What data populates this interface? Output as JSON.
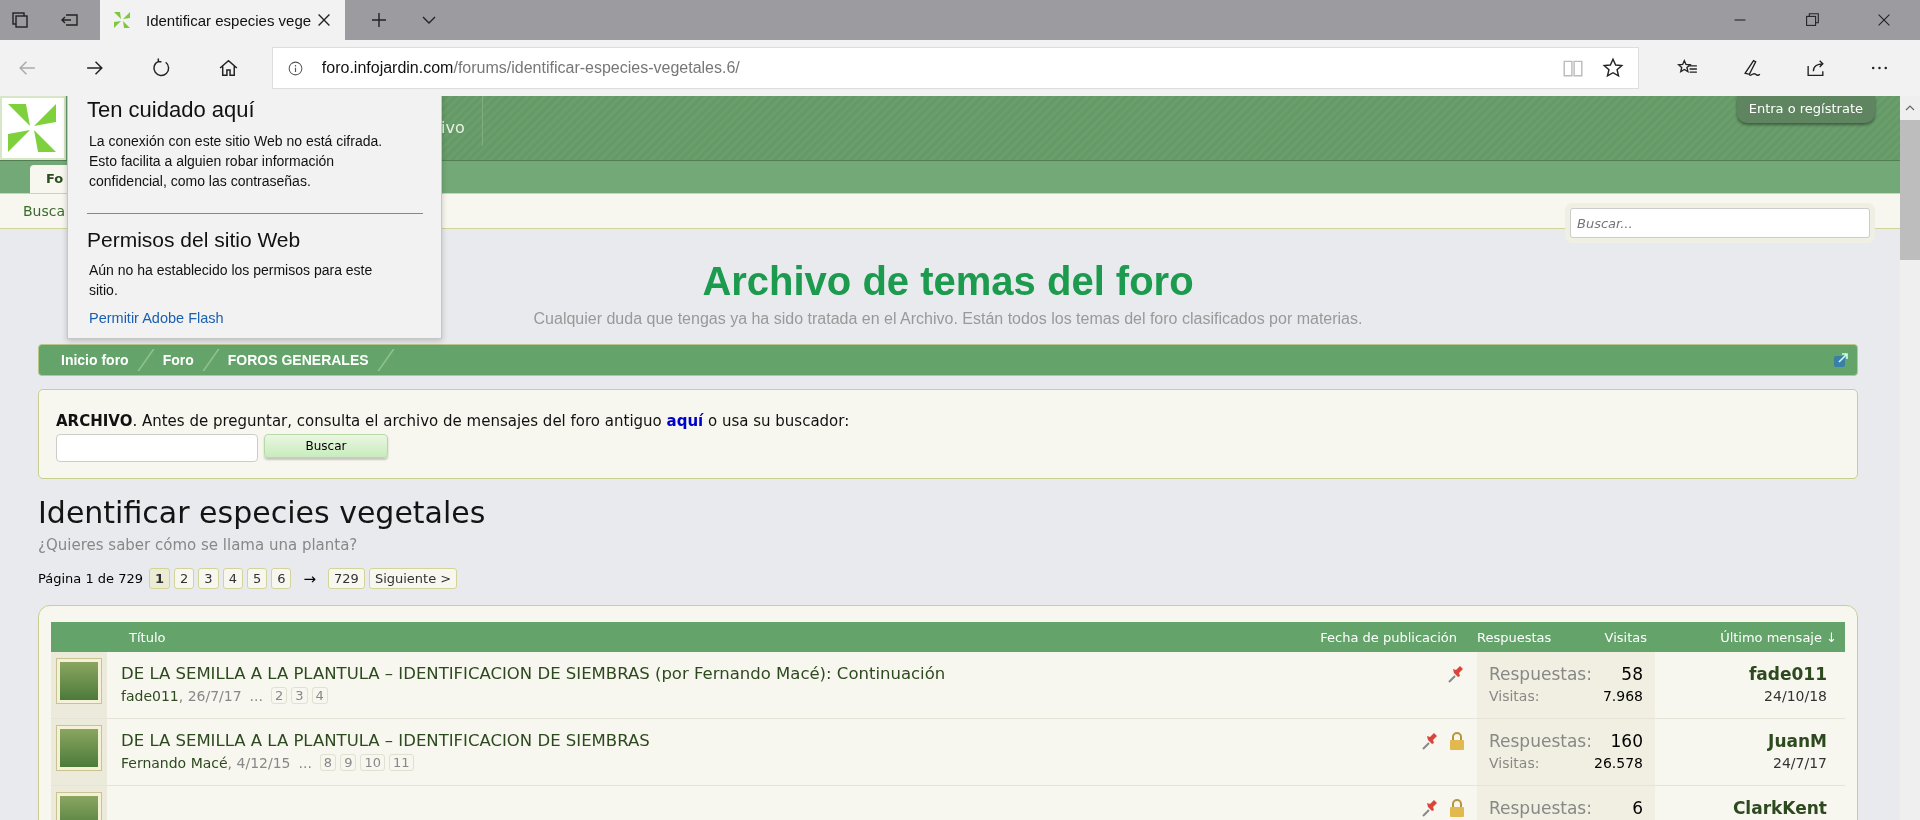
{
  "browser": {
    "tab": {
      "title": "Identificar especies vege"
    },
    "address": {
      "domain": "foro.infojardin.com",
      "path": "/forums/identificar-especies-vegetales.6/"
    }
  },
  "site_info_popup": {
    "title": "Ten cuidado aquí",
    "warning": "La conexión con este sitio Web no está cifrada. Esto facilita a alguien robar información confidencial, como las contraseñas.",
    "permissions_title": "Permisos del sitio Web",
    "permissions_text": "Aún no ha establecido los permisos para este sitio.",
    "link": "Permitir Adobe Flash"
  },
  "header": {
    "nav_item": "ivo",
    "login_button": "Entra o regístrate"
  },
  "tabs": [
    {
      "label": "Fo",
      "selected": true
    }
  ],
  "subnav": {
    "link": "Busca",
    "search": {
      "placeholder": "Buscar..."
    }
  },
  "banner": {
    "title": "Archivo de temas del foro",
    "subtitle": "Cualquier duda que tengas ya ha sido tratada en el Archivo. Están todos los temas del foro clasificados por materias."
  },
  "breadcrumb": [
    "Inicio foro",
    "Foro",
    "FOROS GENERALES"
  ],
  "archive_box": {
    "lead": "**ARCHIVO**. Antes de preguntar, consulta el archivo de mensajes del foro antiguo",
    "link": "aquí",
    "tail": "o usa su buscador:",
    "button": "Buscar"
  },
  "forum": {
    "title": "Identificar especies vegetales",
    "description": "¿Quieres saber cómo se llama una planta?",
    "pagination": {
      "label": "Página 1 de 729",
      "pages": [
        {
          "label": "1",
          "selected": true
        },
        {
          "label": "2",
          "selected": false
        },
        {
          "label": "3",
          "selected": false
        },
        {
          "label": "4",
          "selected": false
        },
        {
          "label": "5",
          "selected": false
        },
        {
          "label": "6",
          "selected": false
        }
      ],
      "arrow": "→",
      "last": "729",
      "next": "Siguiente >"
    }
  },
  "thread_table": {
    "columns": [
      "Título",
      "Fecha de publicación",
      "Respuestas",
      "Visitas",
      "Último mensaje ↓"
    ],
    "rows": [
      {
        "title": "DE LA SEMILLA A LA PLANTULA – IDENTIFICACION DE SIEMBRAS (por Fernando Macé): Continuación",
        "author": "fade011",
        "date": ", 26/7/17",
        "ellipsis": "...",
        "pages": [
          "2",
          "3",
          "4"
        ],
        "pinned": true,
        "locked": false,
        "replies_label": "Respuestas:",
        "replies": "58",
        "views_label": "Visitas:",
        "views": "7.968",
        "last_user": "fade011",
        "last_date": "24/10/18"
      },
      {
        "title": "DE LA SEMILLA A LA PLANTULA – IDENTIFICACION DE SIEMBRAS",
        "author": "Fernando Macé",
        "date": ", 4/12/15",
        "ellipsis": "...",
        "pages": [
          "8",
          "9",
          "10",
          "11"
        ],
        "pinned": true,
        "locked": true,
        "replies_label": "Respuestas:",
        "replies": "160",
        "views_label": "Visitas:",
        "views": "26.578",
        "last_user": "JuanM",
        "last_date": "24/7/17"
      },
      {
        "pinned": true,
        "locked": true,
        "replies_label": "Respuestas:",
        "replies": "6",
        "last_user": "ClarkKent"
      }
    ]
  }
}
